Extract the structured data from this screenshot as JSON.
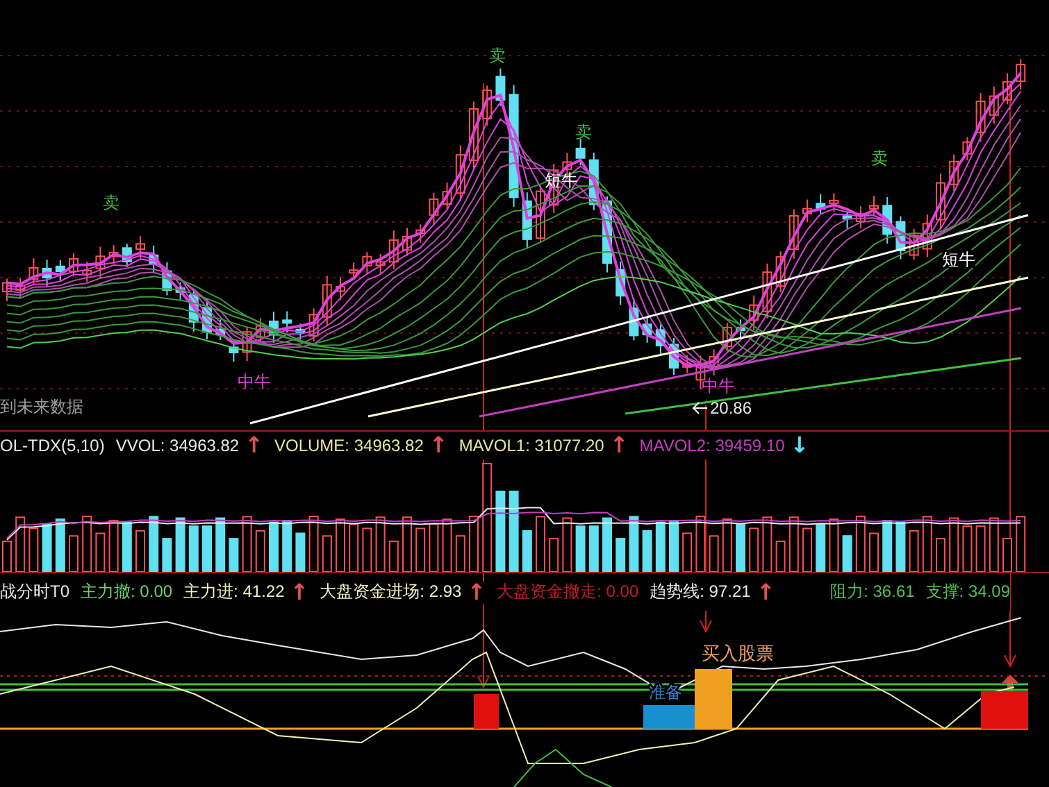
{
  "price_panel": {
    "signals": [
      {
        "text": "卖",
        "kind": "sell"
      },
      {
        "text": "卖",
        "kind": "sell"
      },
      {
        "text": "卖",
        "kind": "sell"
      },
      {
        "text": "卖",
        "kind": "sell"
      },
      {
        "text": "短牛",
        "kind": "short_bull"
      },
      {
        "text": "短牛",
        "kind": "short_bull"
      },
      {
        "text": "中牛",
        "kind": "mid_bull"
      },
      {
        "text": "中牛",
        "kind": "mid_bull"
      }
    ],
    "low_label": "20.86",
    "note": "到未来数据"
  },
  "volume_panel": {
    "legend": [
      {
        "text": "OL-TDX(5,10)",
        "color": "#e8e8e8"
      },
      {
        "text": "VVOL: 34963.82",
        "color": "#e8e8e8",
        "arrow": {
          "text": "↑",
          "color": "#e05050"
        }
      },
      {
        "text": "VOLUME: 34963.82",
        "color": "#e8e8a0",
        "arrow": {
          "text": "↑",
          "color": "#e05050"
        }
      },
      {
        "text": "MAVOL1: 31077.20",
        "color": "#e8e8a0",
        "arrow": {
          "text": "↑",
          "color": "#e05050"
        }
      },
      {
        "text": "MAVOL2: 39459.10",
        "color": "#c040c0",
        "arrow": {
          "text": "↓",
          "color": "#60e0f0"
        }
      }
    ]
  },
  "indicator_panel": {
    "legend": [
      {
        "text": "战分时T0",
        "color": "#e8e8e8"
      },
      {
        "text": "主力撤: 0.00",
        "color": "#70d070"
      },
      {
        "text": "主力进: 41.22",
        "color": "#f0f0c0",
        "arrow": {
          "text": "↑",
          "color": "#e05050"
        }
      },
      {
        "text": "大盘资金进场: 2.93",
        "color": "#f0f0c0",
        "arrow": {
          "text": "↑",
          "color": "#e05050"
        }
      },
      {
        "text": "大盘资金撤走: 0.00",
        "color": "#c02020"
      },
      {
        "text": "趋势线: 97.21",
        "color": "#e8e8e8",
        "arrow": {
          "text": "↑",
          "color": "#e05050"
        }
      }
    ],
    "levels_legend": [
      {
        "text": "阻力: 36.61",
        "color": "#50c050"
      },
      {
        "text": "支撑: 34.09",
        "color": "#50c050"
      }
    ],
    "buy_label": "买入股票",
    "ready_label": "准备"
  }
}
